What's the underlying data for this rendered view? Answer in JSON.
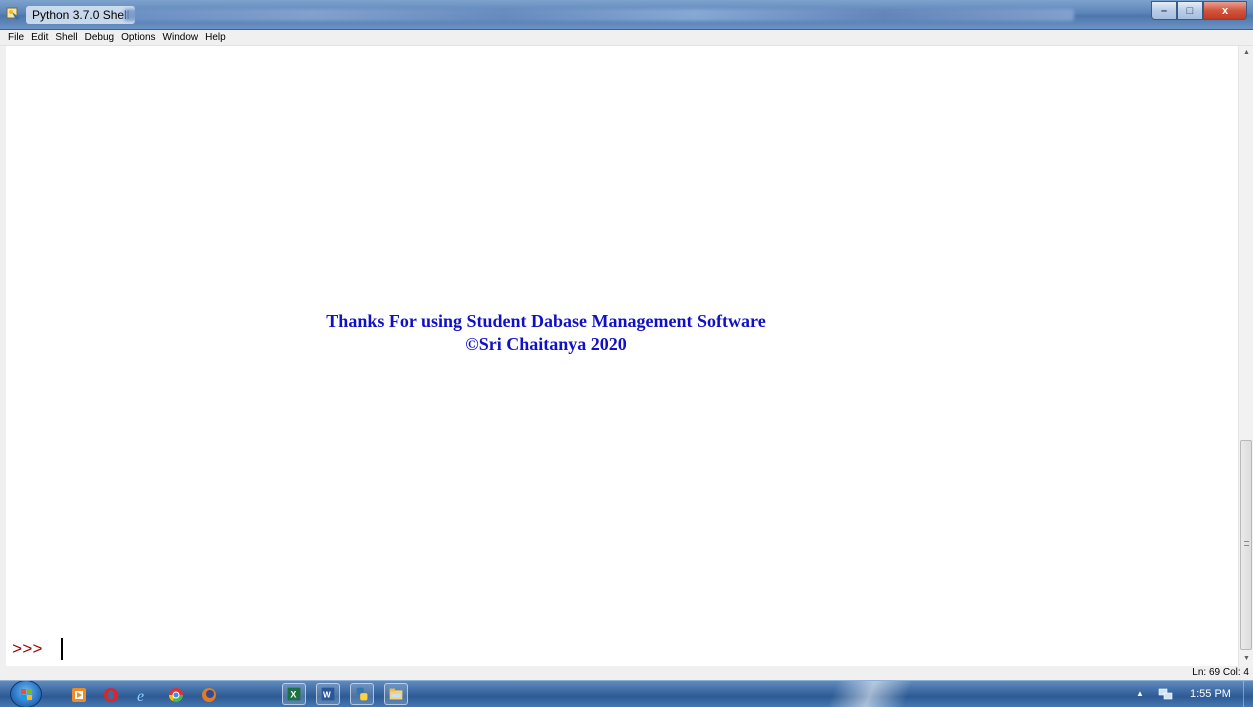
{
  "window": {
    "title": "Python 3.7.0 Shell",
    "buttons": {
      "minimize": "–",
      "maximize": "□",
      "close": "x"
    }
  },
  "menu": [
    "File",
    "Edit",
    "Shell",
    "Debug",
    "Options",
    "Window",
    "Help"
  ],
  "output": {
    "line1": "Thanks For using Student Dabase Management Software",
    "line2": "©Sri Chaitanya 2020",
    "text_color": "#1010c8"
  },
  "prompt": {
    "text": ">>>",
    "color": "#a40000"
  },
  "status": {
    "position": "Ln: 69   Col: 4"
  },
  "taskbar": {
    "clock": "1:55 PM",
    "icons": [
      "start-orb",
      "media-player-icon",
      "opera-icon",
      "internet-explorer-icon",
      "chrome-icon",
      "firefox-icon",
      "excel-icon",
      "word-icon",
      "python-icon",
      "file-explorer-icon"
    ]
  }
}
